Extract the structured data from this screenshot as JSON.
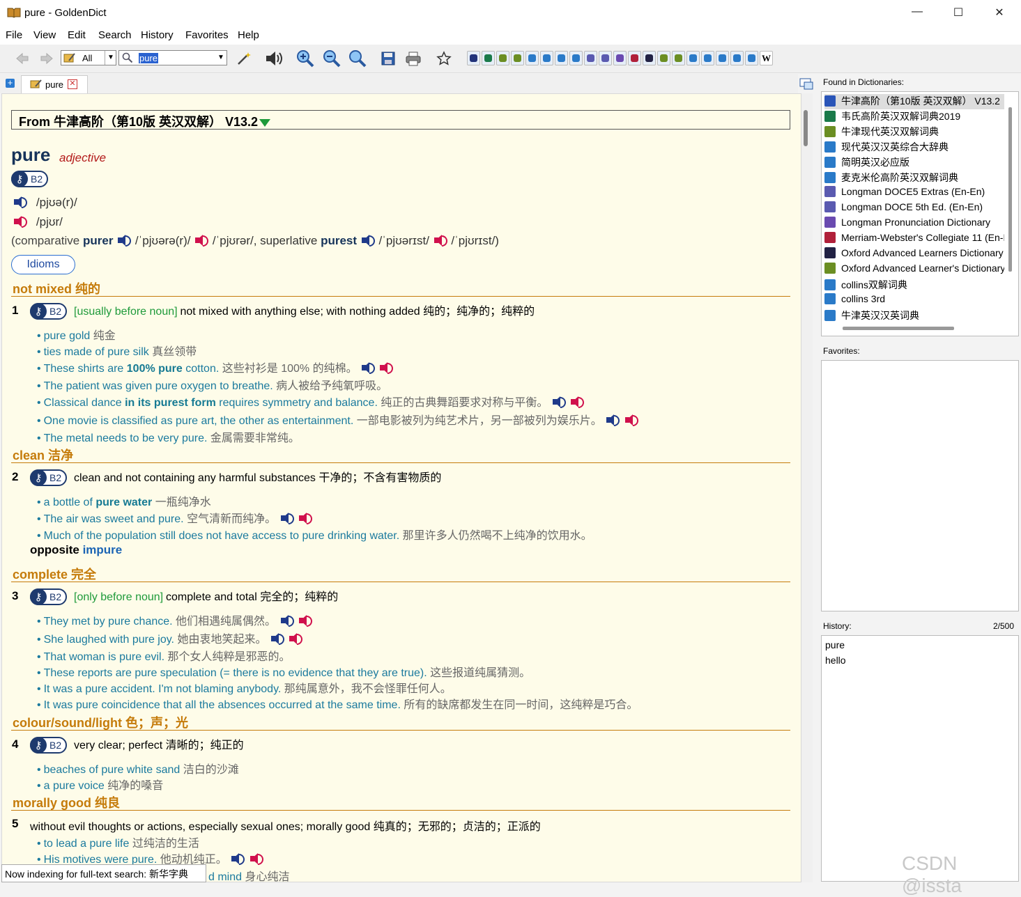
{
  "window": {
    "title": "pure - GoldenDict",
    "controls": [
      "—",
      "☐",
      "✕"
    ]
  },
  "menu": [
    {
      "key": "file",
      "label": "File"
    },
    {
      "key": "view",
      "label": "View"
    },
    {
      "key": "edit",
      "label": "Edit"
    },
    {
      "key": "search",
      "label": "Search"
    },
    {
      "key": "history",
      "label": "History"
    },
    {
      "key": "favorites",
      "label": "Favorites"
    },
    {
      "key": "help",
      "label": "Help"
    }
  ],
  "toolbar": {
    "group_label": "All",
    "search_value": "pure"
  },
  "tabs": [
    {
      "label": "pure"
    }
  ],
  "article": {
    "dict_header": "From 牛津高阶（第10版 英汉双解） V13.2",
    "headword": "pure",
    "pos": "adjective",
    "level": "B2",
    "pron_uk": "/pjʊə(r)/",
    "pron_us": "/pjʊr/",
    "forms": {
      "open": "(comparative ",
      "comparative": "purer",
      "c_uk": " /ˈpjʊərə(r)/ ",
      "c_us": " /ˈpjʊrər/, superlative ",
      "superlative": "purest",
      "s_uk": " /ˈpjʊərɪst/ ",
      "s_us": " /ˈpjʊrɪst/)"
    },
    "idioms_button": "Idioms",
    "shortcuts": [
      {
        "en": "not mixed",
        "zh": "纯的"
      },
      {
        "en": "clean",
        "zh": "洁净"
      },
      {
        "en": "complete",
        "zh": "完全"
      },
      {
        "en": "colour/sound/light",
        "zh": "色；声；光"
      },
      {
        "en": "morally good",
        "zh": "纯良"
      }
    ],
    "senses": [
      {
        "num": "1",
        "grammar": "[usually before noun]",
        "def": "not mixed with anything else; with nothing added 纯的；纯净的；纯粹的"
      },
      {
        "num": "2",
        "def": "clean and not containing any harmful substances 干净的；不含有害物质的"
      },
      {
        "num": "3",
        "grammar": "[only before noun]",
        "def": "complete and total 完全的；纯粹的"
      },
      {
        "num": "4",
        "def": "very clear; perfect 清晰的；纯正的"
      },
      {
        "num": "5",
        "def": "without evil thoughts or actions, especially sexual ones; morally good 纯真的；无邪的；贞洁的；正派的"
      }
    ],
    "examples": {
      "s1": [
        {
          "en": "pure gold",
          "zh": "纯金"
        },
        {
          "en": "ties made of pure silk",
          "zh": "真丝领带"
        },
        {
          "pre": "These shirts are ",
          "b": "100% pure",
          "post": " cotton.",
          "zh": "这些衬衫是 100% 的纯棉。"
        },
        {
          "en": "The patient was given pure oxygen to breathe.",
          "zh": "病人被给予纯氧呼吸。"
        },
        {
          "pre": "Classical dance ",
          "b": "in its purest form",
          "post": " requires symmetry and balance.",
          "zh": "纯正的古典舞蹈要求对称与平衡。"
        },
        {
          "en": "One movie is classified as pure art, the other as entertainment.",
          "zh": "一部电影被列为纯艺术片，另一部被列为娱乐片。"
        },
        {
          "en": "The metal needs to be very pure.",
          "zh": "金属需要非常纯。"
        }
      ],
      "s2": [
        {
          "pre": "a bottle of ",
          "b": "pure water",
          "post": "",
          "zh": "一瓶纯净水"
        },
        {
          "en": "The air was sweet and pure.",
          "zh": "空气清新而纯净。"
        },
        {
          "en": "Much of the population still does not have access to pure drinking water.",
          "zh": "那里许多人仍然喝不上纯净的饮用水。"
        }
      ],
      "s3": [
        {
          "en": "They met by pure chance.",
          "zh": "他们相遇纯属偶然。"
        },
        {
          "en": "She laughed with pure joy.",
          "zh": "她由衷地笑起来。"
        },
        {
          "en": "That woman is pure evil.",
          "zh": "那个女人纯粹是邪恶的。"
        },
        {
          "en": "These reports are pure speculation (= there is no evidence that they are true).",
          "zh": "这些报道纯属猜测。"
        },
        {
          "en": "It was a pure accident. I'm not blaming anybody.",
          "zh": "那纯属意外，我不会怪罪任何人。"
        },
        {
          "en": "It was pure coincidence that all the absences occurred at the same time.",
          "zh": " 所有的缺席都发生在同一时间，这纯粹是巧合。"
        }
      ],
      "s4": [
        {
          "en": "beaches of pure white sand",
          "zh": "洁白的沙滩"
        },
        {
          "en": "a pure voice",
          "zh": "纯净的嗓音"
        }
      ],
      "s5": [
        {
          "en": "to lead a pure life",
          "zh": "过纯洁的生活"
        },
        {
          "en": "His motives were pure.",
          "zh": "他动机纯正。"
        },
        {
          "en": "d mind",
          "zh": "身心纯洁"
        }
      ]
    },
    "opposite_label": "opposite",
    "opposite_word": "impure"
  },
  "right": {
    "found_label": "Found in Dictionaries:",
    "found": [
      "牛津高阶（第10版 英汉双解） V13.2",
      "韦氏高阶英汉双解词典2019",
      "牛津现代英汉双解词典",
      "现代英汉汉英综合大辞典",
      "简明英汉必应版",
      "麦克米伦高阶英汉双解词典",
      "Longman DOCE5 Extras (En-En)",
      "Longman DOCE 5th Ed. (En-En)",
      "Longman Pronunciation Dictionary",
      "Merriam-Webster's Collegiate 11 (En-En)",
      "Oxford Advanced Learners Dictionary",
      "Oxford Advanced Learner's Dictionary",
      "collins双解词典",
      "collins 3rd",
      "牛津英汉汉英词典"
    ],
    "found_colors": [
      "#2a55b8",
      "#1a7a4a",
      "#6b8e23",
      "#2a7ac8",
      "#2a7ac8",
      "#2a7ac8",
      "#5a5ab0",
      "#5a5ab0",
      "#6a4ab0",
      "#b0203a",
      "#222244",
      "#6b8e23",
      "#2a7ac8",
      "#2a7ac8",
      "#2a7ac8"
    ],
    "favorites_label": "Favorites:",
    "history_label": "History:",
    "history_count": "2/500",
    "history": [
      "pure",
      "hello"
    ]
  },
  "status": "Now indexing for full-text search: 新华字典",
  "watermark": "CSDN @issta"
}
